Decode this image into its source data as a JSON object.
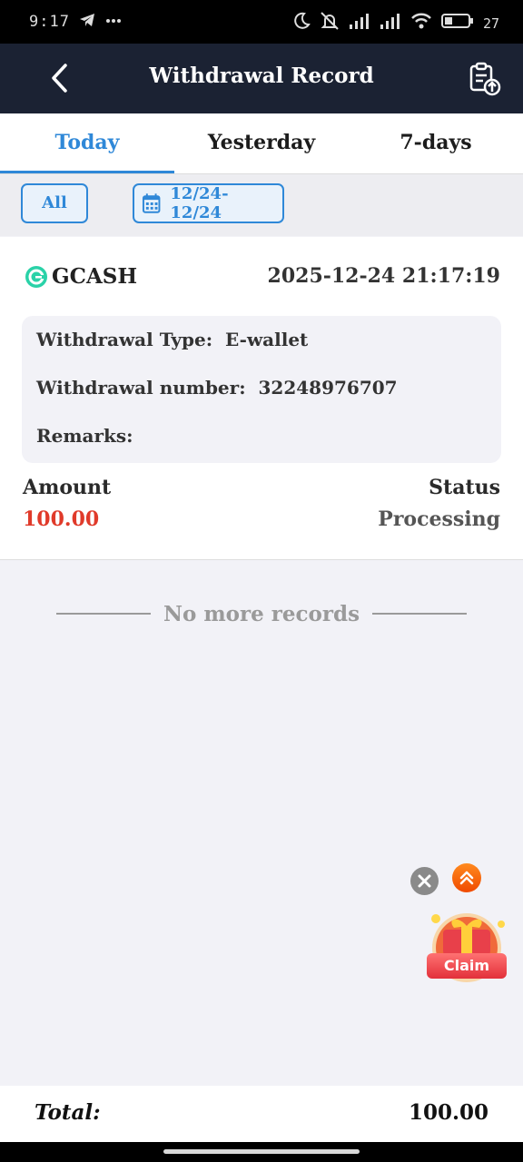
{
  "status_bar": {
    "time": "9:17",
    "battery": "27",
    "icons": [
      "telegram-icon",
      "more-dots-icon",
      "moon-icon",
      "mute-icon",
      "signal-icon",
      "signal-icon",
      "wifi-icon",
      "battery-icon"
    ]
  },
  "header": {
    "title": "Withdrawal Record"
  },
  "tabs": [
    {
      "label": "Today",
      "active": true
    },
    {
      "label": "Yesterday",
      "active": false
    },
    {
      "label": "7-days",
      "active": false
    }
  ],
  "filters": {
    "type_label": "All",
    "date_range": "12/24- 12/24"
  },
  "record": {
    "method": "GCASH",
    "datetime": "2025-12-24 21:17:19",
    "type_label": "Withdrawal Type:",
    "type_value": "E-wallet",
    "number_label": "Withdrawal number:",
    "number_value": "32248976707",
    "remarks_label": "Remarks:",
    "remarks_value": "",
    "amount_label": "Amount",
    "amount_value": "100.00",
    "status_label": "Status",
    "status_value": "Processing"
  },
  "list_end_text": "No more records",
  "floating": {
    "claim_label": "Claim"
  },
  "footer": {
    "total_label": "Total:",
    "total_value": "100.00"
  },
  "colors": {
    "accent": "#2f88d8",
    "header_bg": "#1b2233",
    "amount": "#e03a2a"
  }
}
